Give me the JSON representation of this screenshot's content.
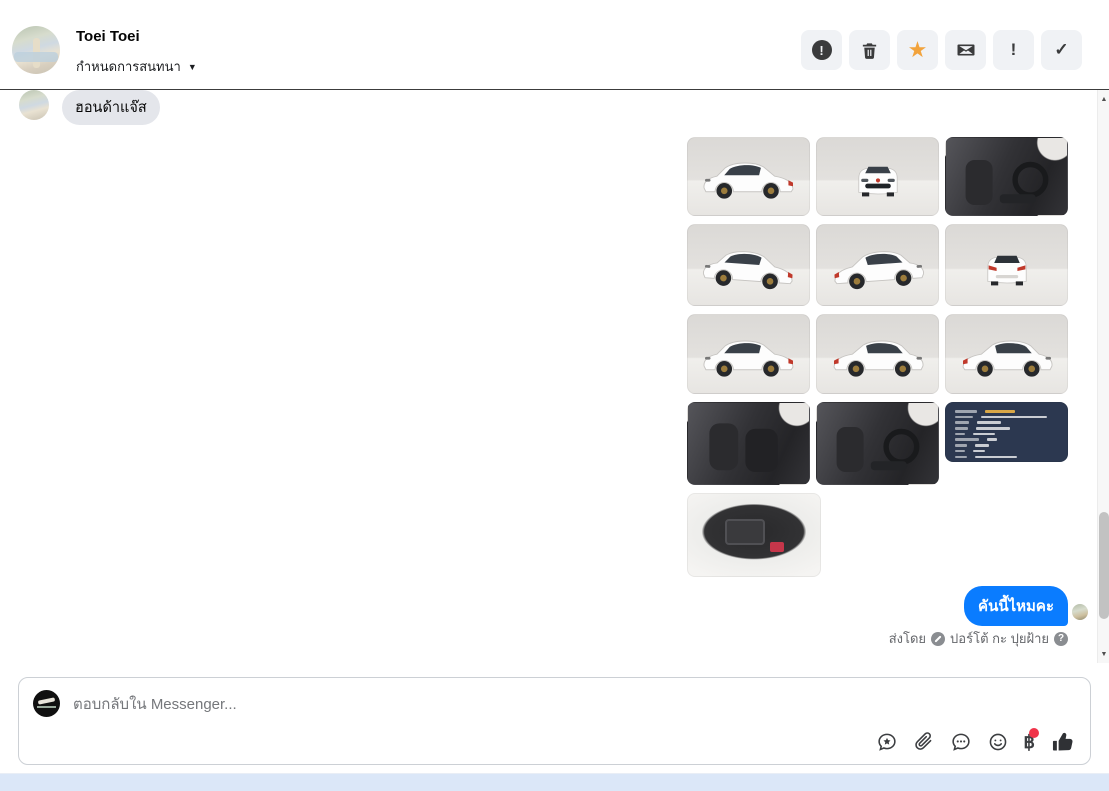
{
  "header": {
    "name": "Toei Toei",
    "conversation_label": "กำหนดการสนทนา",
    "action_icons": [
      "report-icon",
      "trash-icon",
      "star-icon",
      "envelope-icon",
      "exclamation-icon",
      "check-icon"
    ]
  },
  "glyphs": {
    "caret_down": "▼",
    "star": "★",
    "exclamation": "!",
    "check": "✓",
    "question": "?",
    "baht": "฿",
    "arrow_up": "▲",
    "arrow_down": "▼"
  },
  "chat": {
    "incoming": {
      "text": "ฮอนด้าแจ๊ส"
    },
    "photos": [
      "car-front-left",
      "car-front",
      "interior-dashboard",
      "car-rear-left",
      "car-front-right",
      "car-rear",
      "car-rear-right",
      "car-side",
      "car-side-2",
      "interior-rear-seats",
      "interior-front-seats",
      "spec-sheet",
      "engine-bay"
    ],
    "outgoing": {
      "text": "คันนี้ไหมคะ"
    },
    "sent_by": {
      "prefix": "ส่งโดย",
      "page_name": "ปอร์โต้ กะ ปุยฝ้าย"
    }
  },
  "composer": {
    "placeholder": "ตอบกลับใน Messenger..."
  },
  "colors": {
    "accent_blue": "#0a7cff",
    "incoming_bubble": "#e4e6eb",
    "star_orange": "#f2a33c",
    "notification_red": "#f0344a",
    "bottom_bar_blue": "#dbe7f8",
    "spec_card_navy": "#2c3850",
    "action_button_bg": "#f0f2f5"
  }
}
